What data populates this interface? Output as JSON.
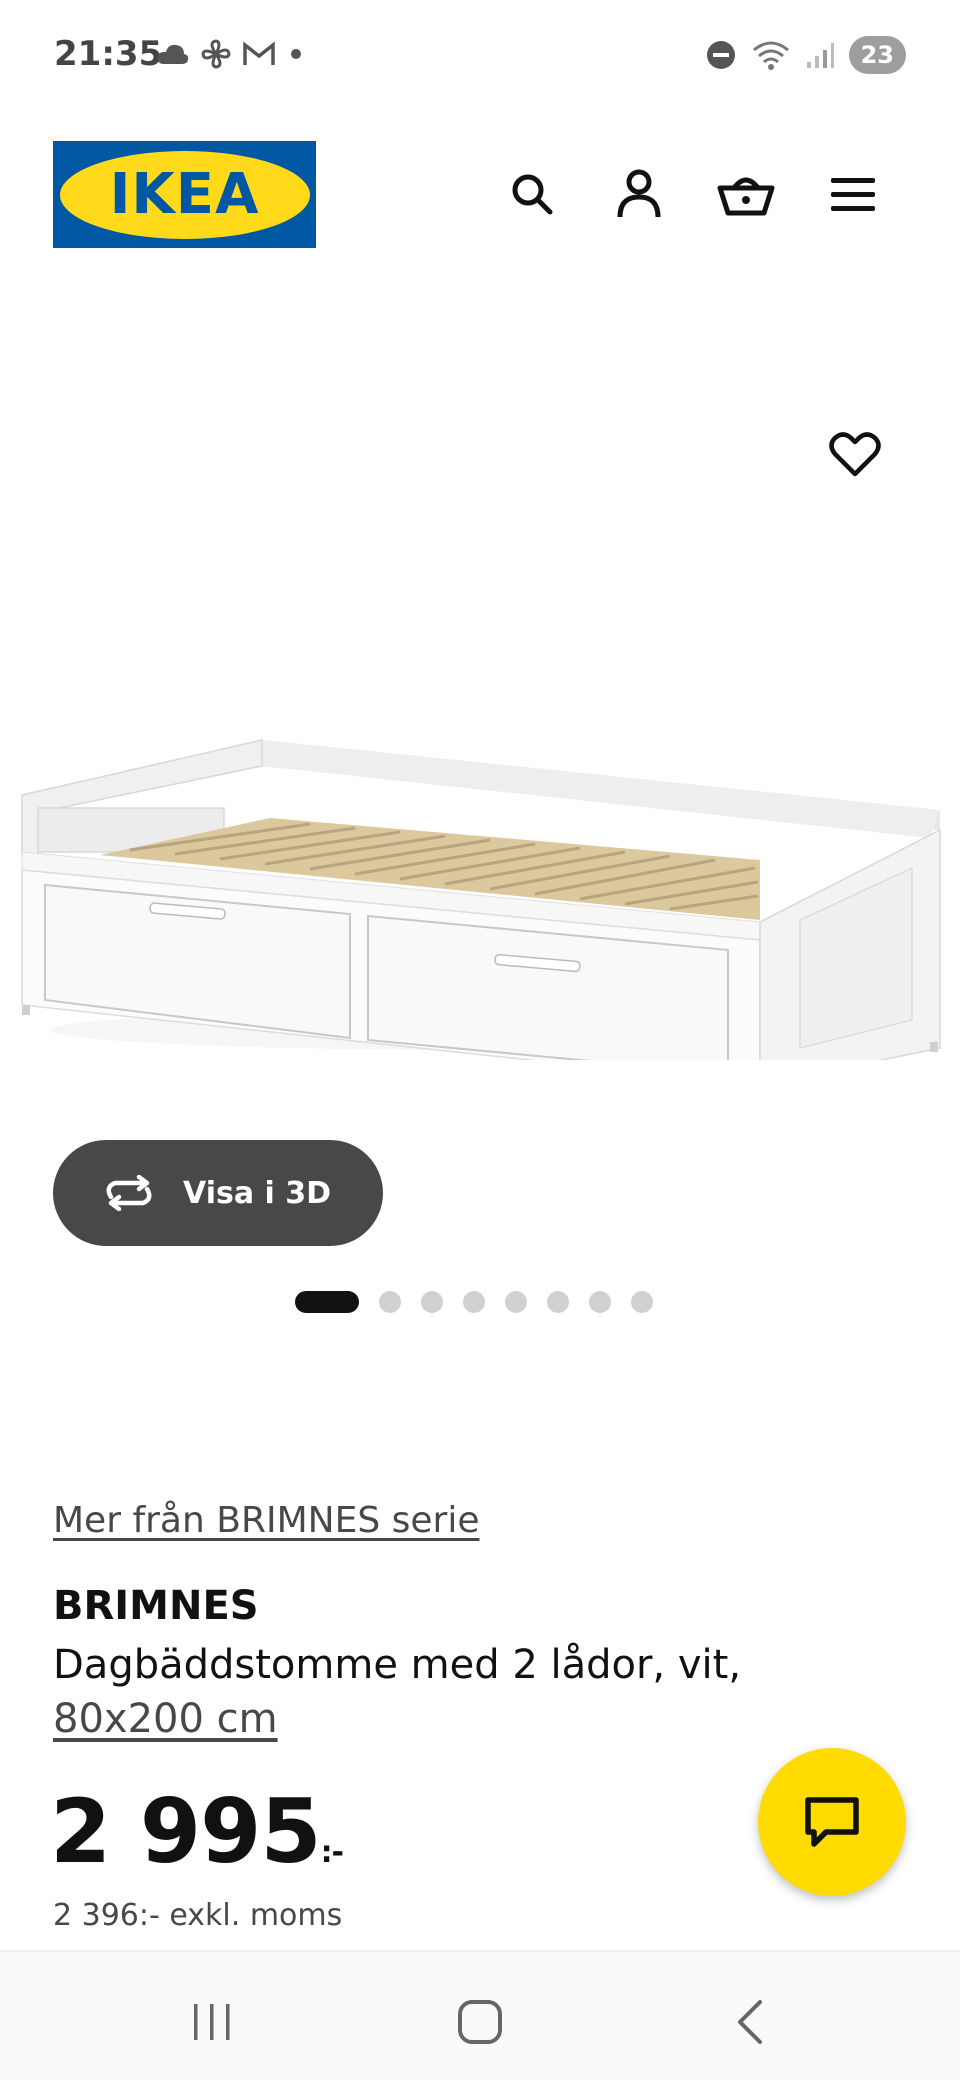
{
  "status_bar": {
    "time": "21:35",
    "left_icons": [
      "cloud-icon",
      "fan-icon",
      "gmail-icon",
      "dot-icon"
    ],
    "right_icons": [
      "do-not-disturb-icon",
      "wifi-icon",
      "signal-icon"
    ],
    "battery": "23"
  },
  "header": {
    "logo_text": "IKEA",
    "brand_colors": {
      "blue": "#0058a3",
      "yellow": "#ffda1a"
    },
    "icons": [
      "search-icon",
      "account-icon",
      "cart-icon",
      "menu-icon"
    ]
  },
  "gallery": {
    "view_3d_label": "Visa i 3D",
    "image_count": 8,
    "active_image": 1
  },
  "product": {
    "series_link": "Mer från BRIMNES serie",
    "name": "BRIMNES",
    "description": "Dagbäddstomme med 2 lådor, vit,",
    "size": "80x200 cm",
    "price": "2 995",
    "price_suffix": ":-",
    "price_exkl": "2 396:- exkl. moms"
  },
  "chat": {
    "icon": "chat-icon",
    "color": "#ffdb00"
  },
  "nav_bar": {
    "icons": [
      "recent-apps-icon",
      "home-icon",
      "back-icon"
    ]
  }
}
